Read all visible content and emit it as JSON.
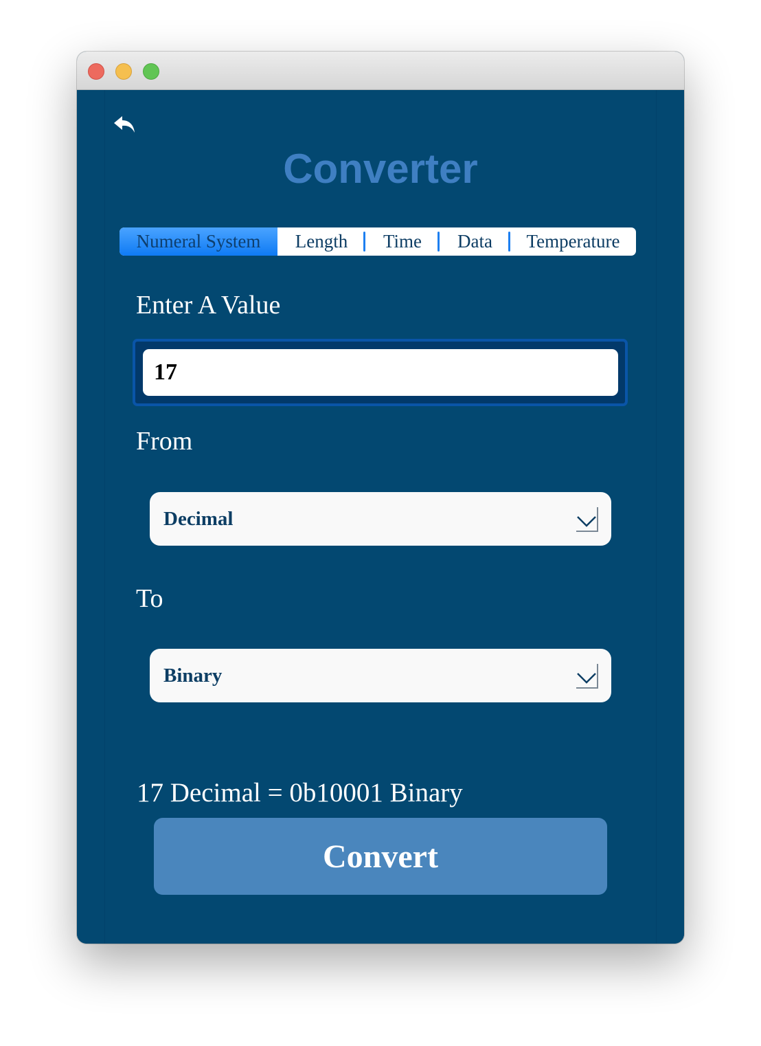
{
  "window": {
    "traffic_lights": [
      "close",
      "minimize",
      "zoom"
    ]
  },
  "app": {
    "back_icon": "back-arrow-icon",
    "title": "Converter"
  },
  "tabs": [
    {
      "label": "Numeral System",
      "active": true
    },
    {
      "label": "Length",
      "active": false
    },
    {
      "label": "Time",
      "active": false
    },
    {
      "label": "Data",
      "active": false
    },
    {
      "label": "Temperature",
      "active": false
    }
  ],
  "form": {
    "value_label": "Enter A Value",
    "value": "17",
    "from_label": "From",
    "from_value": "Decimal",
    "to_label": "To",
    "to_value": "Binary",
    "result": "17 Decimal = 0b10001 Binary",
    "convert_label": "Convert"
  },
  "colors": {
    "background": "#034871",
    "title": "#3f7fc2",
    "tab_active": "#1f86f7",
    "button": "#4a86bd"
  }
}
